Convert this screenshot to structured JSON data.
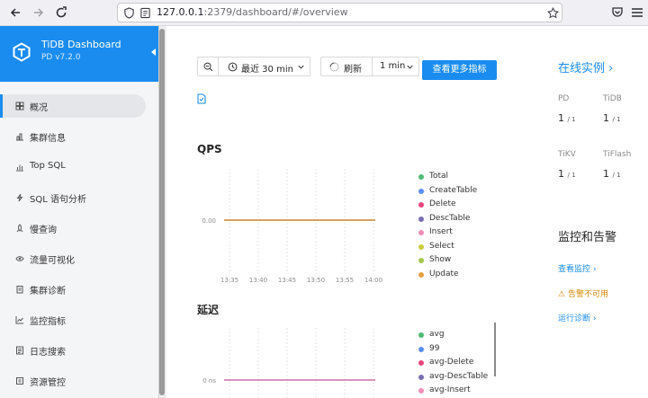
{
  "browser": {
    "url_host": "127.0.0.1",
    "url_rest": ":2379/dashboard/#/overview"
  },
  "sidebar": {
    "app_title": "TiDB Dashboard",
    "version": "PD v7.2.0",
    "active_index": 0,
    "items": [
      {
        "label": "概况",
        "icon": "overview-icon"
      },
      {
        "label": "集群信息",
        "icon": "cluster-icon"
      },
      {
        "label": "Top SQL",
        "icon": "bar-chart-icon"
      },
      {
        "label": "SQL 语句分析",
        "icon": "lightning-icon"
      },
      {
        "label": "慢查询",
        "icon": "rocket-icon"
      },
      {
        "label": "流量可视化",
        "icon": "eye-icon"
      },
      {
        "label": "集群诊断",
        "icon": "diagnose-icon"
      },
      {
        "label": "监控指标",
        "icon": "line-chart-icon"
      },
      {
        "label": "日志搜索",
        "icon": "log-icon"
      },
      {
        "label": "资源管控",
        "icon": "resource-icon"
      }
    ]
  },
  "toolbar": {
    "time_range": "最近 30 min",
    "refresh_label": "刷新",
    "interval": "1 min",
    "more_metrics": "查看更多指标"
  },
  "colors": {
    "accent": "#1a8cf0",
    "warning": "#d48806",
    "line": "#e3a047"
  },
  "charts": {
    "qps": {
      "title": "QPS",
      "y_tick": "0.00",
      "x_ticks": [
        "13:35",
        "13:40",
        "13:45",
        "13:50",
        "13:55",
        "14:00"
      ]
    },
    "latency": {
      "title": "延迟",
      "y_tick": "0 ns"
    }
  },
  "chart_data": [
    {
      "type": "line",
      "title": "QPS",
      "x": [
        "13:35",
        "13:40",
        "13:45",
        "13:50",
        "13:55",
        "14:00"
      ],
      "ylim": [
        0,
        0
      ],
      "series": [
        {
          "name": "Total",
          "color": "#4dbd74",
          "values": [
            0,
            0,
            0,
            0,
            0,
            0
          ]
        },
        {
          "name": "CreateTable",
          "color": "#5b8ff9",
          "values": [
            0,
            0,
            0,
            0,
            0,
            0
          ]
        },
        {
          "name": "Delete",
          "color": "#e8457d",
          "values": [
            0,
            0,
            0,
            0,
            0,
            0
          ]
        },
        {
          "name": "DescTable",
          "color": "#7a6fb3",
          "values": [
            0,
            0,
            0,
            0,
            0,
            0
          ]
        },
        {
          "name": "Insert",
          "color": "#f08db8",
          "values": [
            0,
            0,
            0,
            0,
            0,
            0
          ]
        },
        {
          "name": "Select",
          "color": "#c9cc3f",
          "values": [
            0,
            0,
            0,
            0,
            0,
            0
          ]
        },
        {
          "name": "Show",
          "color": "#a3c94c",
          "values": [
            0,
            0,
            0,
            0,
            0,
            0
          ]
        },
        {
          "name": "Update",
          "color": "#e3a047",
          "values": [
            0,
            0,
            0,
            0,
            0,
            0
          ]
        }
      ],
      "grid": true,
      "legend": "right"
    },
    {
      "type": "line",
      "title": "延迟",
      "ylim": [
        0,
        0
      ],
      "series": [
        {
          "name": "avg",
          "color": "#4dbd74",
          "values": [
            0,
            0,
            0,
            0,
            0,
            0
          ]
        },
        {
          "name": "99",
          "color": "#5b8ff9",
          "values": [
            0,
            0,
            0,
            0,
            0,
            0
          ]
        },
        {
          "name": "avg-Delete",
          "color": "#e8457d",
          "values": [
            0,
            0,
            0,
            0,
            0,
            0
          ]
        },
        {
          "name": "avg-DescTable",
          "color": "#7a6fb3",
          "values": [
            0,
            0,
            0,
            0,
            0,
            0
          ]
        },
        {
          "name": "avg-Insert",
          "color": "#f08db8",
          "values": [
            0,
            0,
            0,
            0,
            0,
            0
          ]
        }
      ],
      "grid": true,
      "legend": "right"
    }
  ],
  "instances": {
    "title": "在线实例",
    "items": [
      {
        "label": "PD",
        "up": "1",
        "total": "/ 1"
      },
      {
        "label": "TiDB",
        "up": "1",
        "total": "/ 1"
      },
      {
        "label": "TiKV",
        "up": "1",
        "total": "/ 1"
      },
      {
        "label": "TiFlash",
        "up": "1",
        "total": "/ 1"
      }
    ]
  },
  "monitoring": {
    "title": "监控和告警",
    "view_metrics": "查看监控",
    "alert_unavailable": "告警不可用",
    "run_diagnosis": "运行诊断"
  }
}
